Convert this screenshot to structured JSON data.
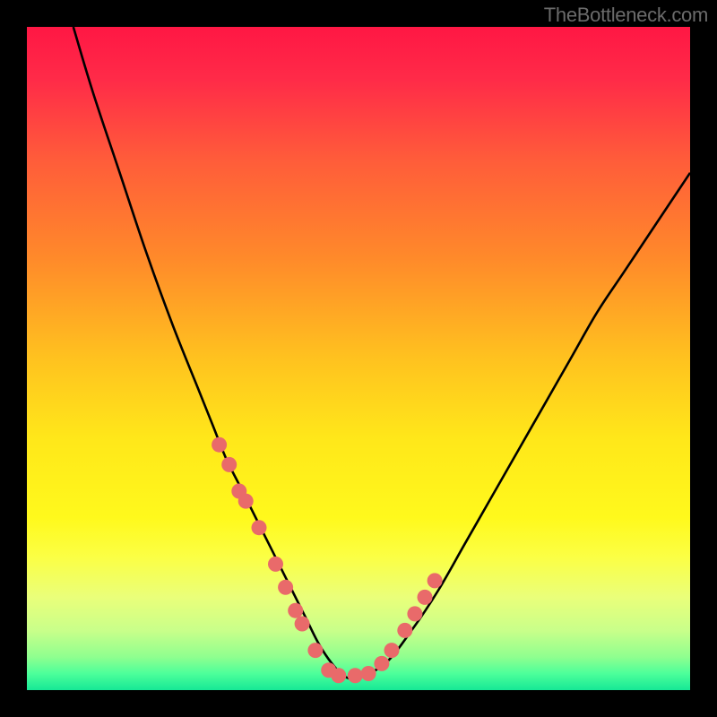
{
  "watermark": "TheBottleneck.com",
  "chart_data": {
    "type": "line",
    "title": "",
    "xlabel": "",
    "ylabel": "",
    "xlim": [
      0,
      100
    ],
    "ylim": [
      0,
      100
    ],
    "series": [
      {
        "name": "curve",
        "x": [
          7,
          10,
          14,
          18,
          22,
          26,
          28,
          30,
          32,
          34,
          36,
          38,
          40,
          42,
          44,
          46,
          48,
          50,
          54,
          58,
          62,
          66,
          70,
          74,
          78,
          82,
          86,
          90,
          94,
          98,
          100
        ],
        "y": [
          100,
          90,
          78,
          66,
          55,
          45,
          40,
          35,
          31,
          27,
          23,
          19,
          15,
          11,
          7,
          4,
          2,
          2,
          4,
          9,
          15,
          22,
          29,
          36,
          43,
          50,
          57,
          63,
          69,
          75,
          78
        ]
      }
    ],
    "markers": {
      "name": "highlighted-points",
      "x": [
        29.0,
        30.5,
        32.0,
        33.0,
        35.0,
        37.5,
        39.0,
        40.5,
        41.5,
        43.5,
        45.5,
        47.0,
        49.5,
        51.5,
        53.5,
        55.0,
        57.0,
        58.5,
        60.0,
        61.5
      ],
      "y": [
        37.0,
        34.0,
        30.0,
        28.5,
        24.5,
        19.0,
        15.5,
        12.0,
        10.0,
        6.0,
        3.0,
        2.2,
        2.2,
        2.5,
        4.0,
        6.0,
        9.0,
        11.5,
        14.0,
        16.5
      ]
    },
    "gradient_stops": [
      {
        "offset": 0.0,
        "color": "#ff1744"
      },
      {
        "offset": 0.08,
        "color": "#ff2b48"
      },
      {
        "offset": 0.2,
        "color": "#ff5c3a"
      },
      {
        "offset": 0.35,
        "color": "#ff8a2a"
      },
      {
        "offset": 0.5,
        "color": "#ffc21f"
      },
      {
        "offset": 0.62,
        "color": "#ffe71a"
      },
      {
        "offset": 0.74,
        "color": "#fff91c"
      },
      {
        "offset": 0.8,
        "color": "#fbff45"
      },
      {
        "offset": 0.86,
        "color": "#eaff7a"
      },
      {
        "offset": 0.91,
        "color": "#c9ff8a"
      },
      {
        "offset": 0.95,
        "color": "#8fff8f"
      },
      {
        "offset": 0.975,
        "color": "#4dff9a"
      },
      {
        "offset": 1.0,
        "color": "#16e896"
      }
    ],
    "marker_color": "#e96a6a",
    "curve_color": "#000000"
  }
}
